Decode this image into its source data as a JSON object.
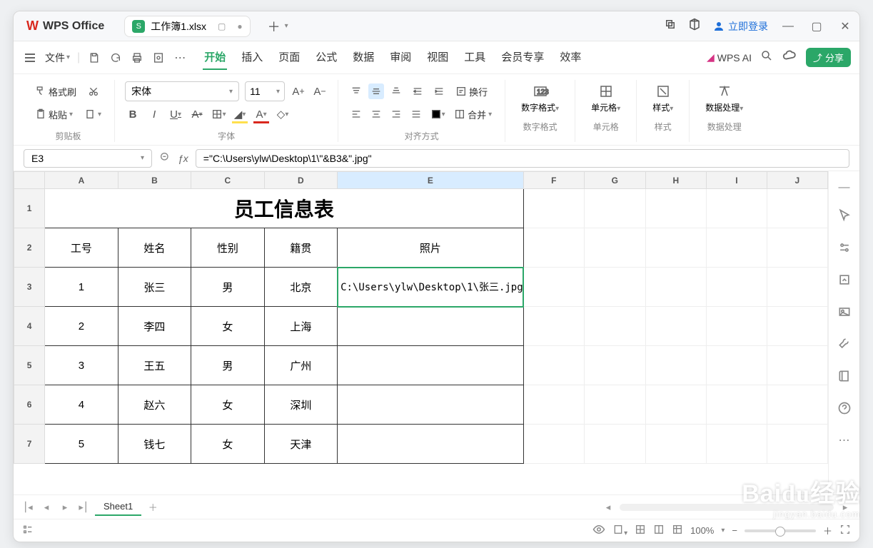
{
  "titlebar": {
    "app": "WPS Office",
    "doc": "工作簿1.xlsx",
    "login": "立即登录"
  },
  "menu": {
    "file": "文件",
    "tabs": [
      "开始",
      "插入",
      "页面",
      "公式",
      "数据",
      "审阅",
      "视图",
      "工具",
      "会员专享",
      "效率"
    ],
    "active": 0,
    "wpsai": "WPS AI",
    "share": "分享"
  },
  "ribbon": {
    "clip": {
      "brush": "格式刷",
      "paste": "粘贴",
      "label": "剪贴板"
    },
    "font": {
      "name": "宋体",
      "size": "11",
      "label": "字体"
    },
    "align": {
      "wrap": "换行",
      "merge": "合并",
      "label": "对齐方式"
    },
    "num": {
      "btn": "数字格式",
      "label": "数字格式"
    },
    "cells": {
      "btn": "单元格",
      "label": "单元格"
    },
    "style": {
      "btn": "样式",
      "label": "样式"
    },
    "proc": {
      "btn": "数据处理",
      "label": "数据处理"
    }
  },
  "formula": {
    "cell": "E3",
    "content": "=\"C:\\Users\\ylw\\Desktop\\1\\\"&B3&\".jpg\""
  },
  "sheet": {
    "cols": [
      "A",
      "B",
      "C",
      "D",
      "E",
      "F",
      "G",
      "H",
      "I",
      "J"
    ],
    "title": "员工信息表",
    "headers": [
      "工号",
      "姓名",
      "性别",
      "籍贯",
      "照片"
    ],
    "rows": [
      [
        "1",
        "张三",
        "男",
        "北京",
        "C:\\Users\\ylw\\Desktop\\1\\张三.jpg"
      ],
      [
        "2",
        "李四",
        "女",
        "上海",
        ""
      ],
      [
        "3",
        "王五",
        "男",
        "广州",
        ""
      ],
      [
        "4",
        "赵六",
        "女",
        "深圳",
        ""
      ],
      [
        "5",
        "钱七",
        "女",
        "天津",
        ""
      ]
    ],
    "selected_col": "E"
  },
  "sheetbar": {
    "name": "Sheet1"
  },
  "status": {
    "zoom": "100%"
  },
  "watermark": {
    "top": "Bai&#x1D555;&#x00E9;经验",
    "bottom": "jingyan.baidu.com"
  }
}
